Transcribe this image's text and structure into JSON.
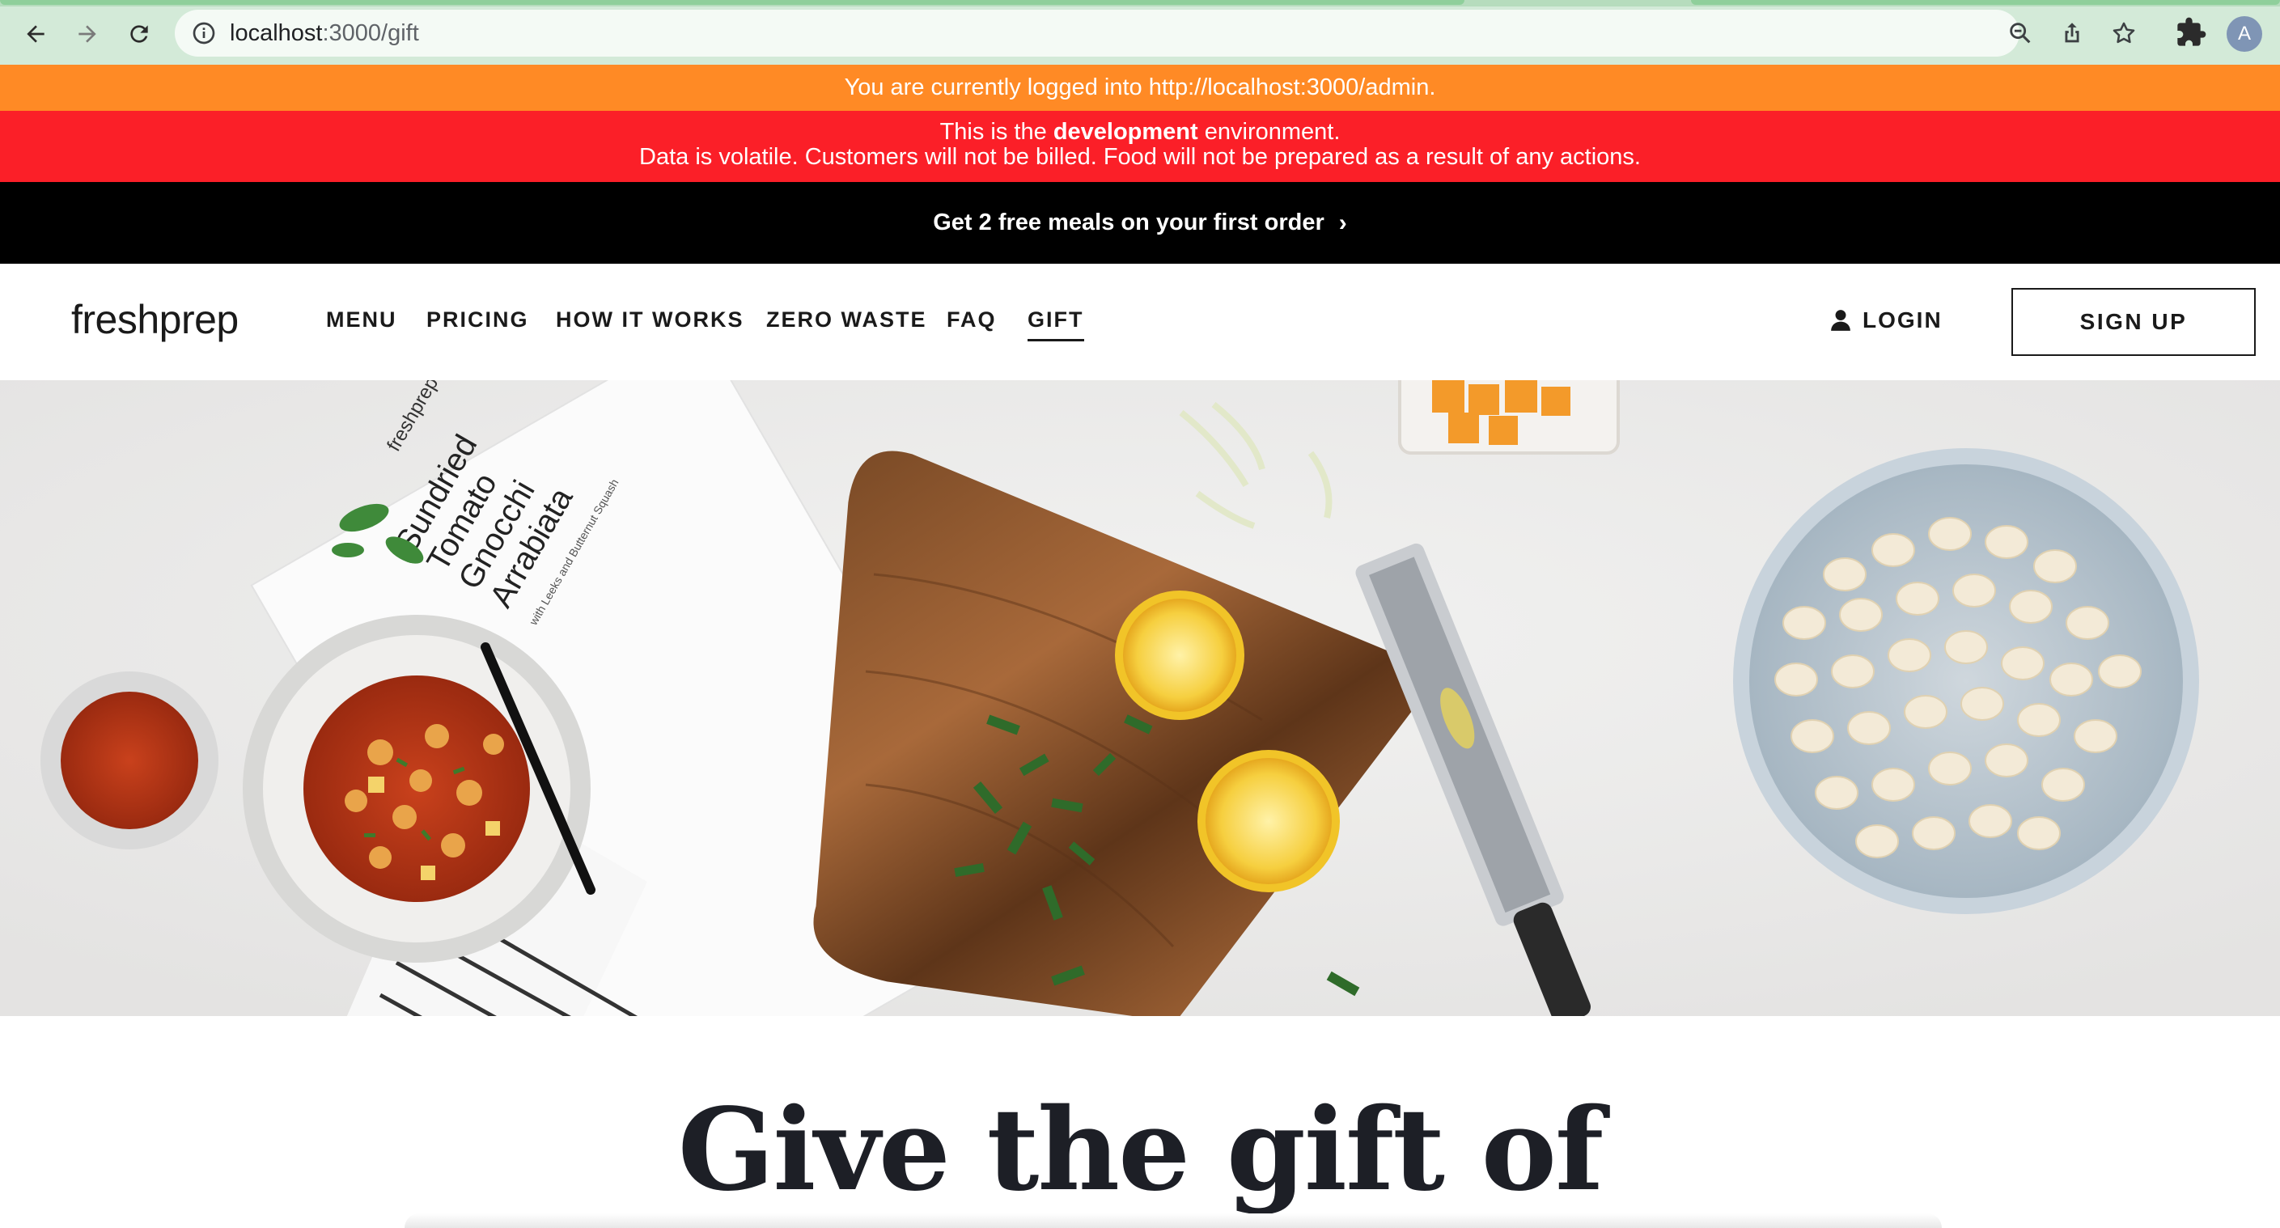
{
  "browser": {
    "url_host": "localhost",
    "url_path": ":3000/gift",
    "profile_initial": "A"
  },
  "banners": {
    "login_notice": "You are currently logged into http://localhost:3000/admin.",
    "env_prefix": "This is the ",
    "env_name": "development",
    "env_suffix": " environment.",
    "env_warning": "Data is volatile. Customers will not be billed. Food will not be prepared as a result of any actions."
  },
  "promo": {
    "text": "Get 2 free meals on your first order",
    "chevron": "›"
  },
  "header": {
    "logo": "freshprep",
    "nav": [
      {
        "label": "MENU"
      },
      {
        "label": "PRICING"
      },
      {
        "label": "HOW IT WORKS"
      },
      {
        "label": "ZERO WASTE"
      },
      {
        "label": "FAQ"
      },
      {
        "label": "GIFT"
      }
    ],
    "active_nav": "GIFT",
    "login": "LOGIN",
    "signup": "SIGN UP"
  },
  "hero": {
    "recipe_card": {
      "brand": "freshprep",
      "title_lines": [
        "Sundried",
        "Tomato",
        "Gnocchi",
        "Arrabiata"
      ],
      "subtitle": "with Leeks and Butternut Squash"
    }
  },
  "main": {
    "headline": "Give the gift of"
  },
  "colors": {
    "chrome": "#d3ead8",
    "banner_orange": "#ff8a25",
    "banner_red": "#fb1f28",
    "promo_bg": "#000000"
  }
}
